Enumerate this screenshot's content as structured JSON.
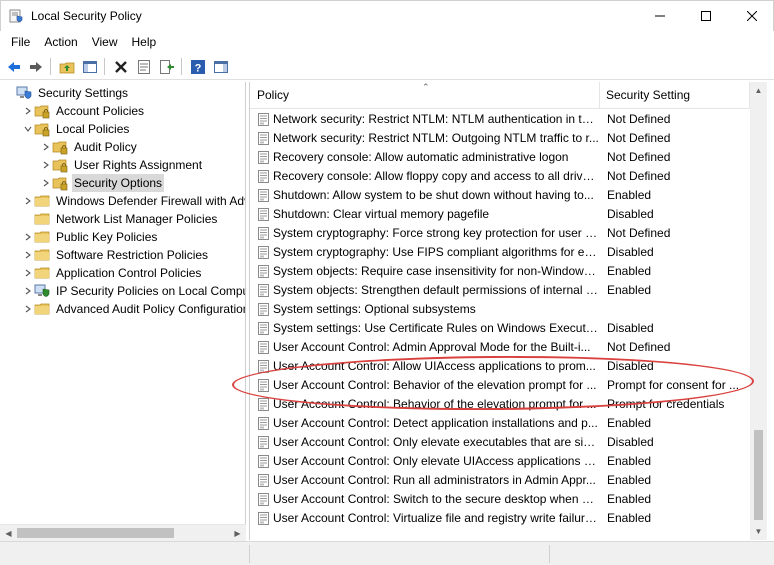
{
  "window": {
    "title": "Local Security Policy",
    "icon": "shield-document-icon"
  },
  "menu": [
    "File",
    "Action",
    "View",
    "Help"
  ],
  "toolbar": {
    "buttons": [
      "back-icon",
      "forward-icon",
      "up-folder-icon",
      "show-hide-tree-icon",
      "delete-icon",
      "properties-icon",
      "export-list-icon",
      "help-icon",
      "show-pane-icon"
    ]
  },
  "tree": [
    {
      "label": "Security Settings",
      "level": 0,
      "expander": "",
      "icon": "shield-computer-icon"
    },
    {
      "label": "Account Policies",
      "level": 1,
      "expander": "collapsed",
      "icon": "folder-lock-icon"
    },
    {
      "label": "Local Policies",
      "level": 1,
      "expander": "expanded",
      "icon": "folder-lock-icon"
    },
    {
      "label": "Audit Policy",
      "level": 2,
      "expander": "collapsed",
      "icon": "folder-lock-icon"
    },
    {
      "label": "User Rights Assignment",
      "level": 2,
      "expander": "collapsed",
      "icon": "folder-lock-icon"
    },
    {
      "label": "Security Options",
      "level": 2,
      "expander": "collapsed",
      "icon": "folder-lock-icon",
      "selected": true
    },
    {
      "label": "Windows Defender Firewall with Adva",
      "level": 1,
      "expander": "collapsed",
      "icon": "folder-icon"
    },
    {
      "label": "Network List Manager Policies",
      "level": 1,
      "expander": "",
      "icon": "folder-icon"
    },
    {
      "label": "Public Key Policies",
      "level": 1,
      "expander": "collapsed",
      "icon": "folder-icon"
    },
    {
      "label": "Software Restriction Policies",
      "level": 1,
      "expander": "collapsed",
      "icon": "folder-icon"
    },
    {
      "label": "Application Control Policies",
      "level": 1,
      "expander": "collapsed",
      "icon": "folder-icon"
    },
    {
      "label": "IP Security Policies on Local Compute",
      "level": 1,
      "expander": "collapsed",
      "icon": "ip-security-icon"
    },
    {
      "label": "Advanced Audit Policy Configuration",
      "level": 1,
      "expander": "collapsed",
      "icon": "folder-icon"
    }
  ],
  "columns": {
    "policy": "Policy",
    "setting": "Security Setting"
  },
  "rows": [
    {
      "policy": "Network security: Restrict NTLM: NTLM authentication in thi...",
      "setting": "Not Defined"
    },
    {
      "policy": "Network security: Restrict NTLM: Outgoing NTLM traffic to r...",
      "setting": "Not Defined"
    },
    {
      "policy": "Recovery console: Allow automatic administrative logon",
      "setting": "Not Defined"
    },
    {
      "policy": "Recovery console: Allow floppy copy and access to all drives...",
      "setting": "Not Defined"
    },
    {
      "policy": "Shutdown: Allow system to be shut down without having to...",
      "setting": "Enabled"
    },
    {
      "policy": "Shutdown: Clear virtual memory pagefile",
      "setting": "Disabled"
    },
    {
      "policy": "System cryptography: Force strong key protection for user k...",
      "setting": "Not Defined"
    },
    {
      "policy": "System cryptography: Use FIPS compliant algorithms for en...",
      "setting": "Disabled"
    },
    {
      "policy": "System objects: Require case insensitivity for non-Windows ...",
      "setting": "Enabled"
    },
    {
      "policy": "System objects: Strengthen default permissions of internal s...",
      "setting": "Enabled"
    },
    {
      "policy": "System settings: Optional subsystems",
      "setting": ""
    },
    {
      "policy": "System settings: Use Certificate Rules on Windows Executab...",
      "setting": "Disabled"
    },
    {
      "policy": "User Account Control: Admin Approval Mode for the Built-i...",
      "setting": "Not Defined"
    },
    {
      "policy": "User Account Control: Allow UIAccess applications to prom...",
      "setting": "Disabled"
    },
    {
      "policy": "User Account Control: Behavior of the elevation prompt for ...",
      "setting": "Prompt for consent for ..."
    },
    {
      "policy": "User Account Control: Behavior of the elevation prompt for ...",
      "setting": "Prompt for credentials"
    },
    {
      "policy": "User Account Control: Detect application installations and p...",
      "setting": "Enabled"
    },
    {
      "policy": "User Account Control: Only elevate executables that are sig...",
      "setting": "Disabled"
    },
    {
      "policy": "User Account Control: Only elevate UIAccess applications th...",
      "setting": "Enabled"
    },
    {
      "policy": "User Account Control: Run all administrators in Admin Appr...",
      "setting": "Enabled"
    },
    {
      "policy": "User Account Control: Switch to the secure desktop when pr...",
      "setting": "Enabled"
    },
    {
      "policy": "User Account Control: Virtualize file and registry write failure...",
      "setting": "Enabled"
    }
  ],
  "colors": {
    "annotation": "#d9423f",
    "selection": "#d9d9d9",
    "toolbar_blue": "#1e6fd9"
  }
}
